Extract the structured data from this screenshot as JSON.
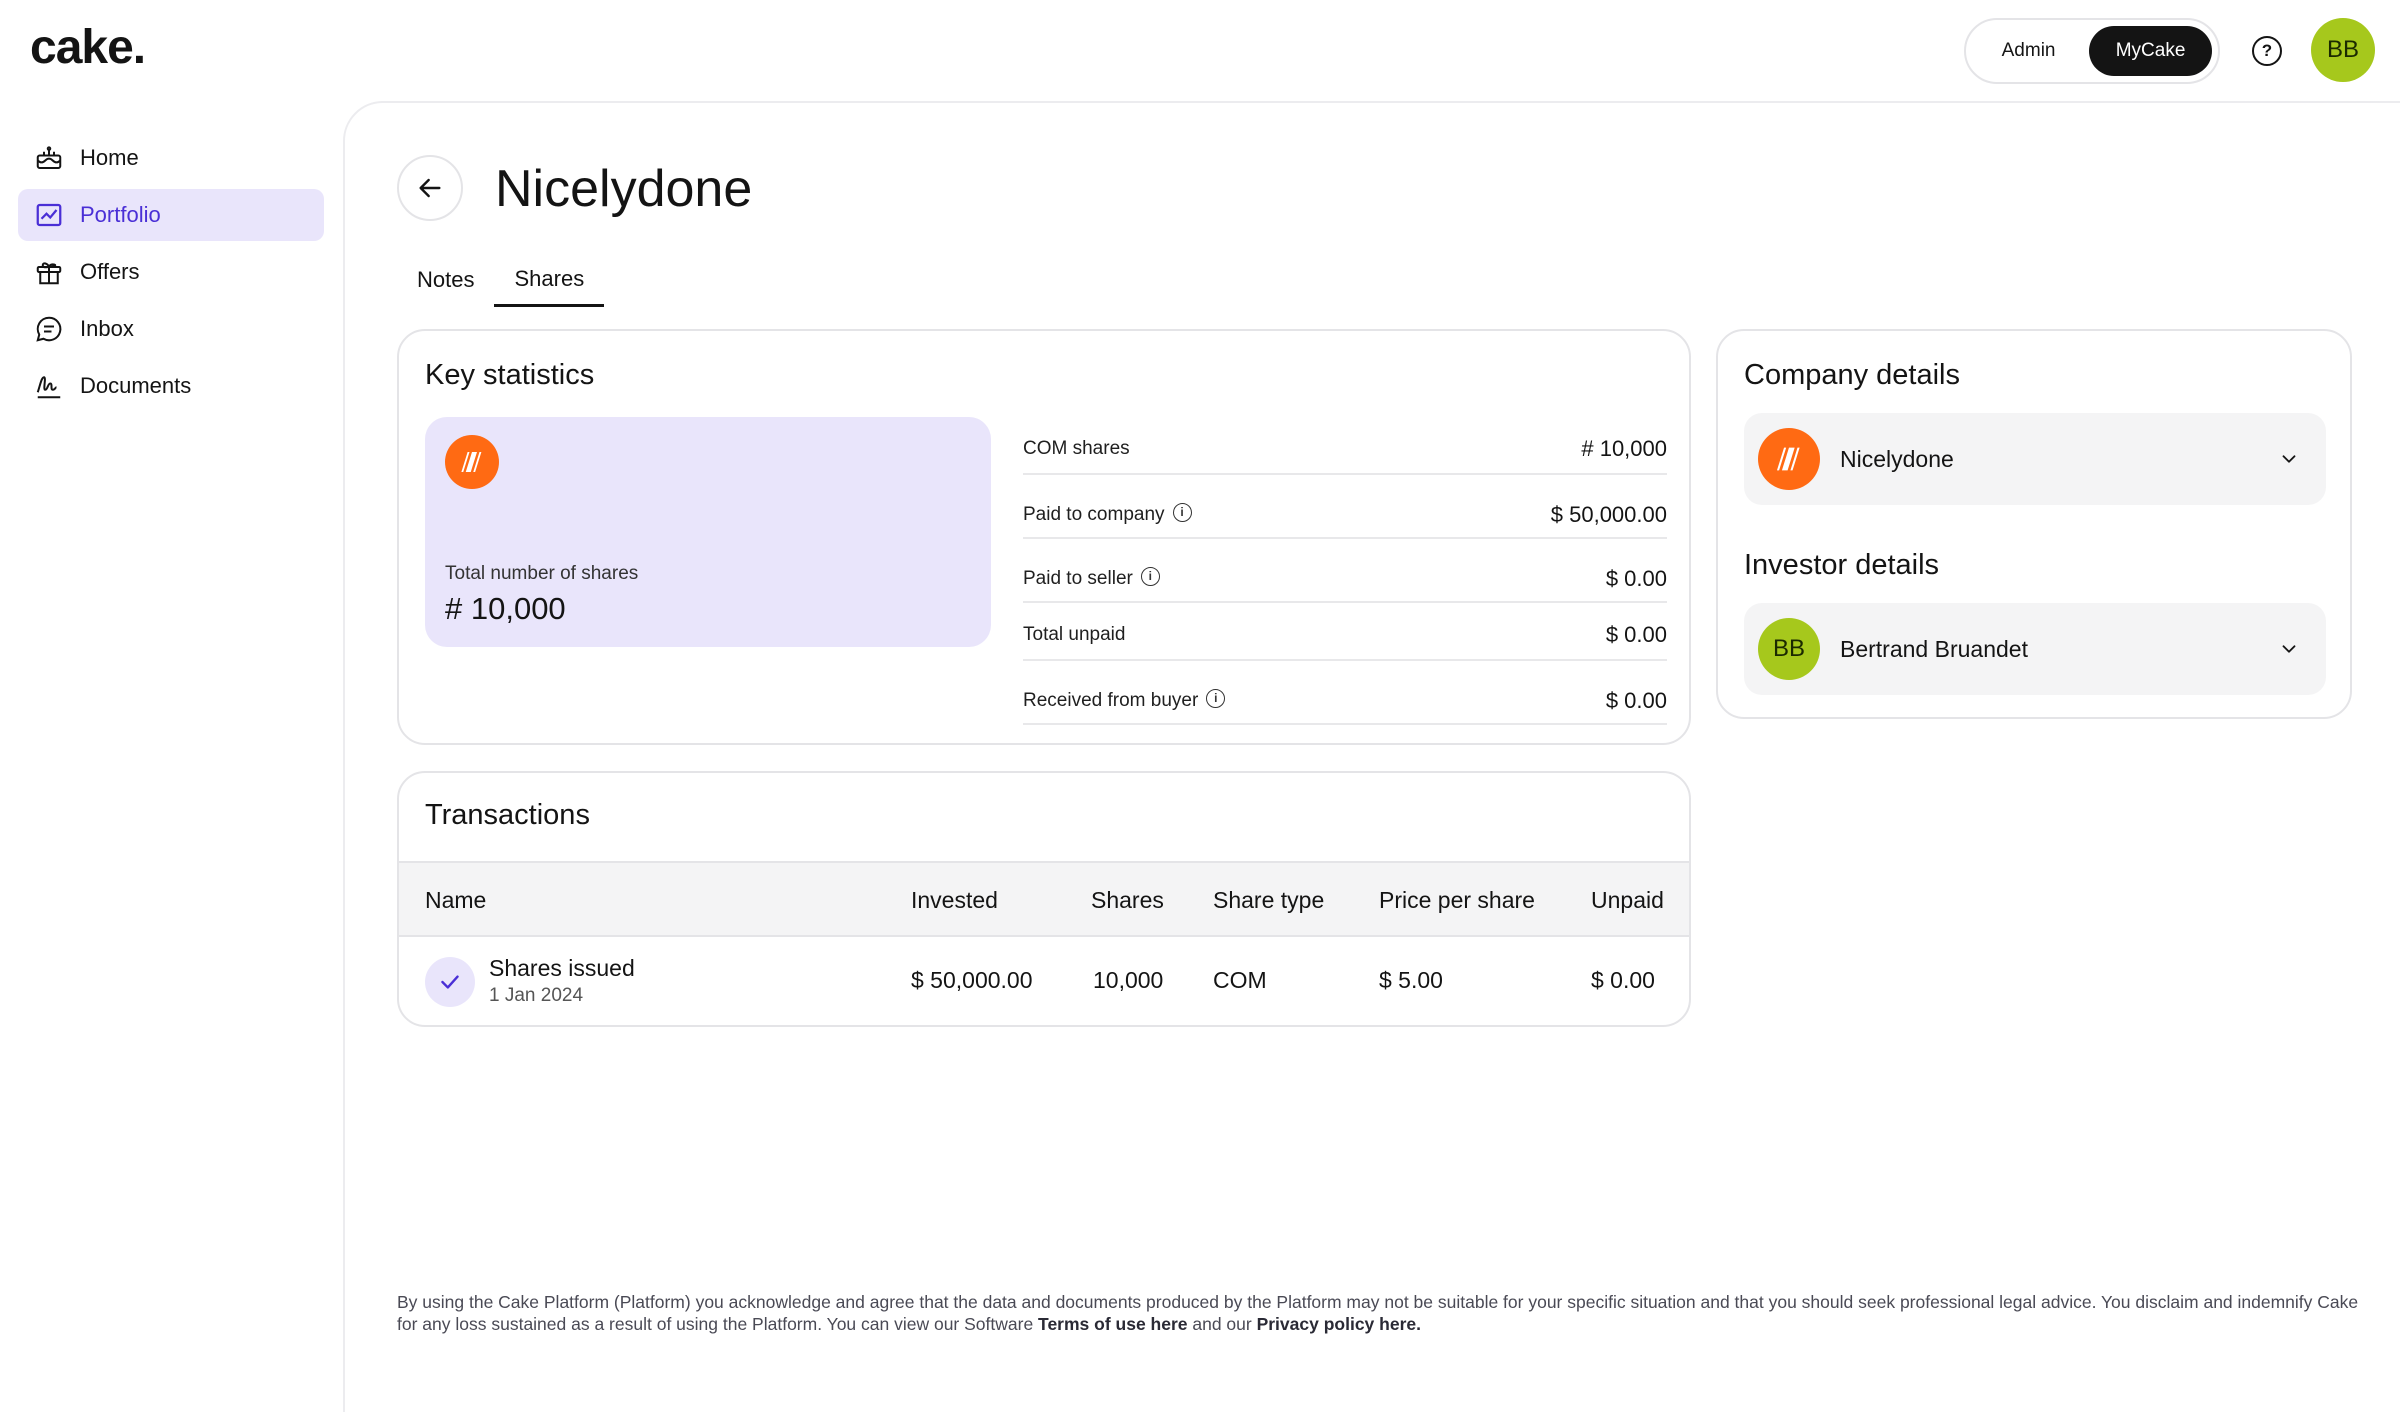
{
  "app": {
    "logo_text": "cake."
  },
  "header": {
    "mode_admin": "Admin",
    "mode_mycake": "MyCake",
    "help_icon": "help-circle-icon",
    "user_initials": "BB",
    "avatar_color": "#a6c81c"
  },
  "sidebar": {
    "items": [
      {
        "label": "Home",
        "icon": "cake-home-icon"
      },
      {
        "label": "Portfolio",
        "icon": "chart-icon",
        "active": true
      },
      {
        "label": "Offers",
        "icon": "gift-icon"
      },
      {
        "label": "Inbox",
        "icon": "chat-bubble-icon"
      },
      {
        "label": "Documents",
        "icon": "signature-icon"
      }
    ]
  },
  "page": {
    "title": "Nicelydone",
    "tabs": [
      {
        "label": "Notes"
      },
      {
        "label": "Shares",
        "active": true
      }
    ]
  },
  "key_statistics": {
    "title": "Key statistics",
    "hero_label": "Total number of shares",
    "hero_value": "# 10,000",
    "rows": [
      {
        "label": "COM shares",
        "value": "# 10,000",
        "info": false
      },
      {
        "label": "Paid to company",
        "value": "$ 50,000.00",
        "info": true
      },
      {
        "label": "Paid to seller",
        "value": "$ 0.00",
        "info": true
      },
      {
        "label": "Total unpaid",
        "value": "$ 0.00",
        "info": false
      },
      {
        "label": "Received from buyer",
        "value": "$ 0.00",
        "info": true
      }
    ]
  },
  "transactions": {
    "title": "Transactions",
    "columns": [
      "Name",
      "Invested",
      "Shares",
      "Share type",
      "Price per share",
      "Unpaid"
    ],
    "rows": [
      {
        "name": "Shares issued",
        "date": "1 Jan 2024",
        "invested": "$ 50,000.00",
        "shares": "10,000",
        "share_type": "COM",
        "price_per_share": "$ 5.00",
        "unpaid": "$ 0.00"
      }
    ]
  },
  "company_details": {
    "title": "Company details",
    "name": "Nicelydone",
    "logo_color": "#ff6a13"
  },
  "investor_details": {
    "title": "Investor details",
    "name": "Bertrand Bruandet",
    "initials": "BB"
  },
  "footer": {
    "text_1": "By using the Cake Platform (Platform) you acknowledge and agree that the data and documents produced by the Platform may not be suitable for your specific situation and that you should seek professional legal advice. You disclaim and indemnify Cake for any loss sustained as a result of using the Platform. You can view our Software ",
    "terms_link": "Terms of use here",
    "text_2": " and our ",
    "privacy_link": "Privacy policy here."
  },
  "colors": {
    "accent": "#4a2fd6",
    "accent_bg": "#e9e5fb",
    "brand_orange": "#ff6a13",
    "text": "#141414"
  }
}
